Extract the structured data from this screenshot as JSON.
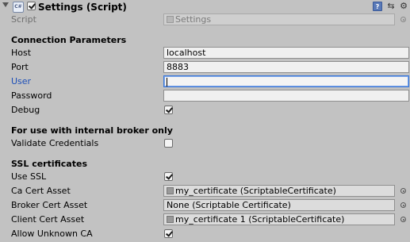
{
  "header": {
    "title": "Settings (Script)",
    "script_icon_text": "C#",
    "enabled": true,
    "icons": [
      "book-icon",
      "preset-icon",
      "gear-icon"
    ]
  },
  "script_row": {
    "label": "Script",
    "value": "Settings"
  },
  "sections": {
    "connection": "Connection Parameters",
    "internal": "For use with internal broker only",
    "ssl": "SSL certificates"
  },
  "fields": {
    "host": {
      "label": "Host",
      "value": "localhost"
    },
    "port": {
      "label": "Port",
      "value": "8883"
    },
    "user": {
      "label": "User",
      "value": ""
    },
    "password": {
      "label": "Password",
      "value": ""
    },
    "debug": {
      "label": "Debug",
      "checked": true
    },
    "validate": {
      "label": "Validate Credentials",
      "checked": false
    },
    "use_ssl": {
      "label": "Use SSL",
      "checked": true
    },
    "ca_cert": {
      "label": "Ca Cert Asset",
      "value": "my_certificate (ScriptableCertificate)"
    },
    "broker_cert": {
      "label": "Broker Cert Asset",
      "value": "None (Scriptable Certificate)"
    },
    "client_cert": {
      "label": "Client Cert Asset",
      "value": "my_certificate 1 (ScriptableCertificate)"
    },
    "allow_unknown_ca": {
      "label": "Allow Unknown CA",
      "checked": true
    }
  },
  "colors": {
    "background": "#c2c2c2",
    "focus_accent": "#3b78d8",
    "active_label": "#1d4fb8"
  }
}
